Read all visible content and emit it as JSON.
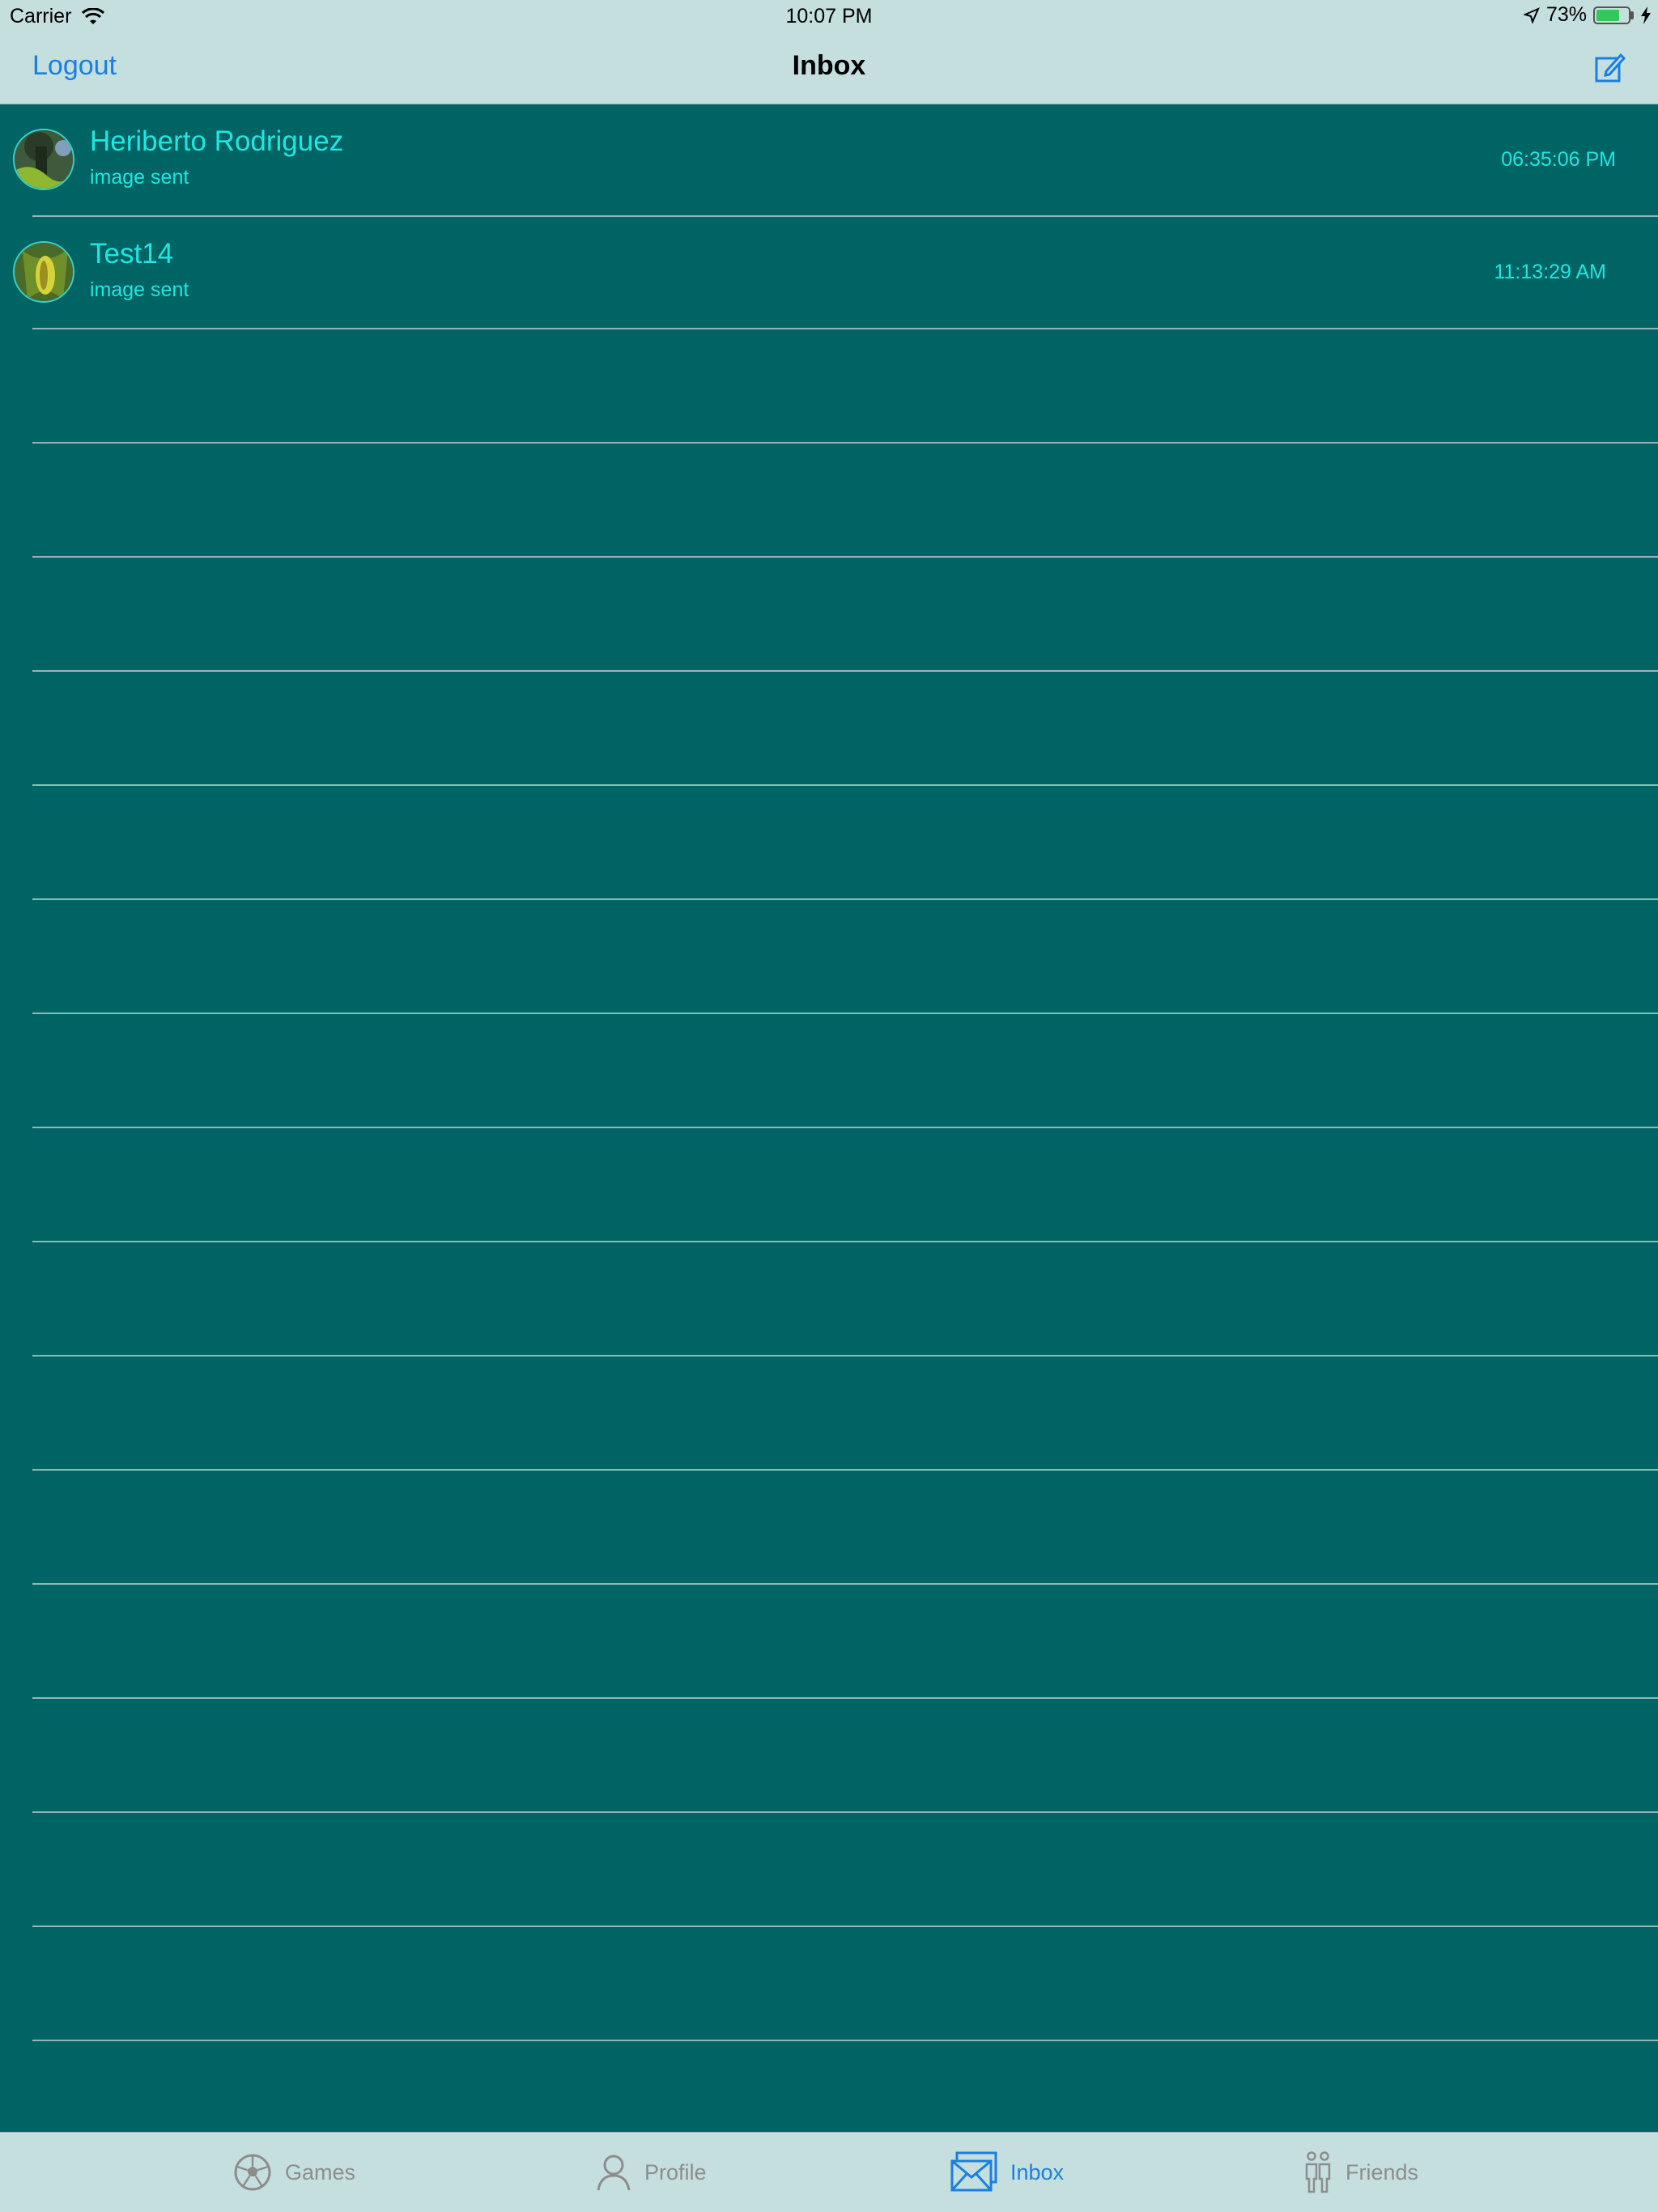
{
  "status_bar": {
    "carrier": "Carrier",
    "time": "10:07 PM",
    "battery_percent": "73%",
    "battery_level": 0.73
  },
  "nav": {
    "left_button": "Logout",
    "title": "Inbox",
    "compose_icon": "compose-icon"
  },
  "messages": [
    {
      "name": "Heriberto Rodriguez",
      "subtitle": "image sent",
      "time": "06:35:06 PM"
    },
    {
      "name": "Test14",
      "subtitle": "image sent",
      "time": "11:13:29 AM"
    }
  ],
  "tabs": [
    {
      "label": "Games",
      "icon": "soccer-ball-icon",
      "active": false
    },
    {
      "label": "Profile",
      "icon": "person-icon",
      "active": false
    },
    {
      "label": "Inbox",
      "icon": "envelope-icon",
      "active": true
    },
    {
      "label": "Friends",
      "icon": "people-icon",
      "active": false
    }
  ],
  "colors": {
    "background": "#006364",
    "bars": "#c5dfdf",
    "accent": "#1a7fe0",
    "cell_text": "#20e6e0"
  }
}
